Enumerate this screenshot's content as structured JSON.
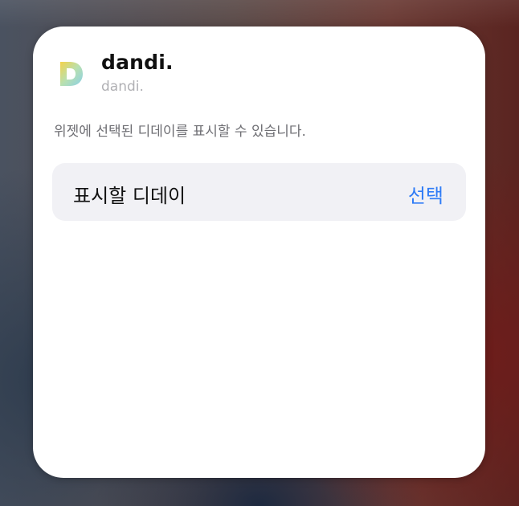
{
  "widget": {
    "app_name": "dandi.",
    "app_subtitle": "dandi.",
    "app_icon": "dandi-logo-icon",
    "description": "위젯에 선택된 디데이를 표시할 수 있습니다.",
    "parameter": {
      "label": "표시할 디데이",
      "action_label": "선택"
    }
  },
  "colors": {
    "accent": "#2f7cf6",
    "card_background": "#ffffff",
    "row_background": "#f1f1f5"
  }
}
